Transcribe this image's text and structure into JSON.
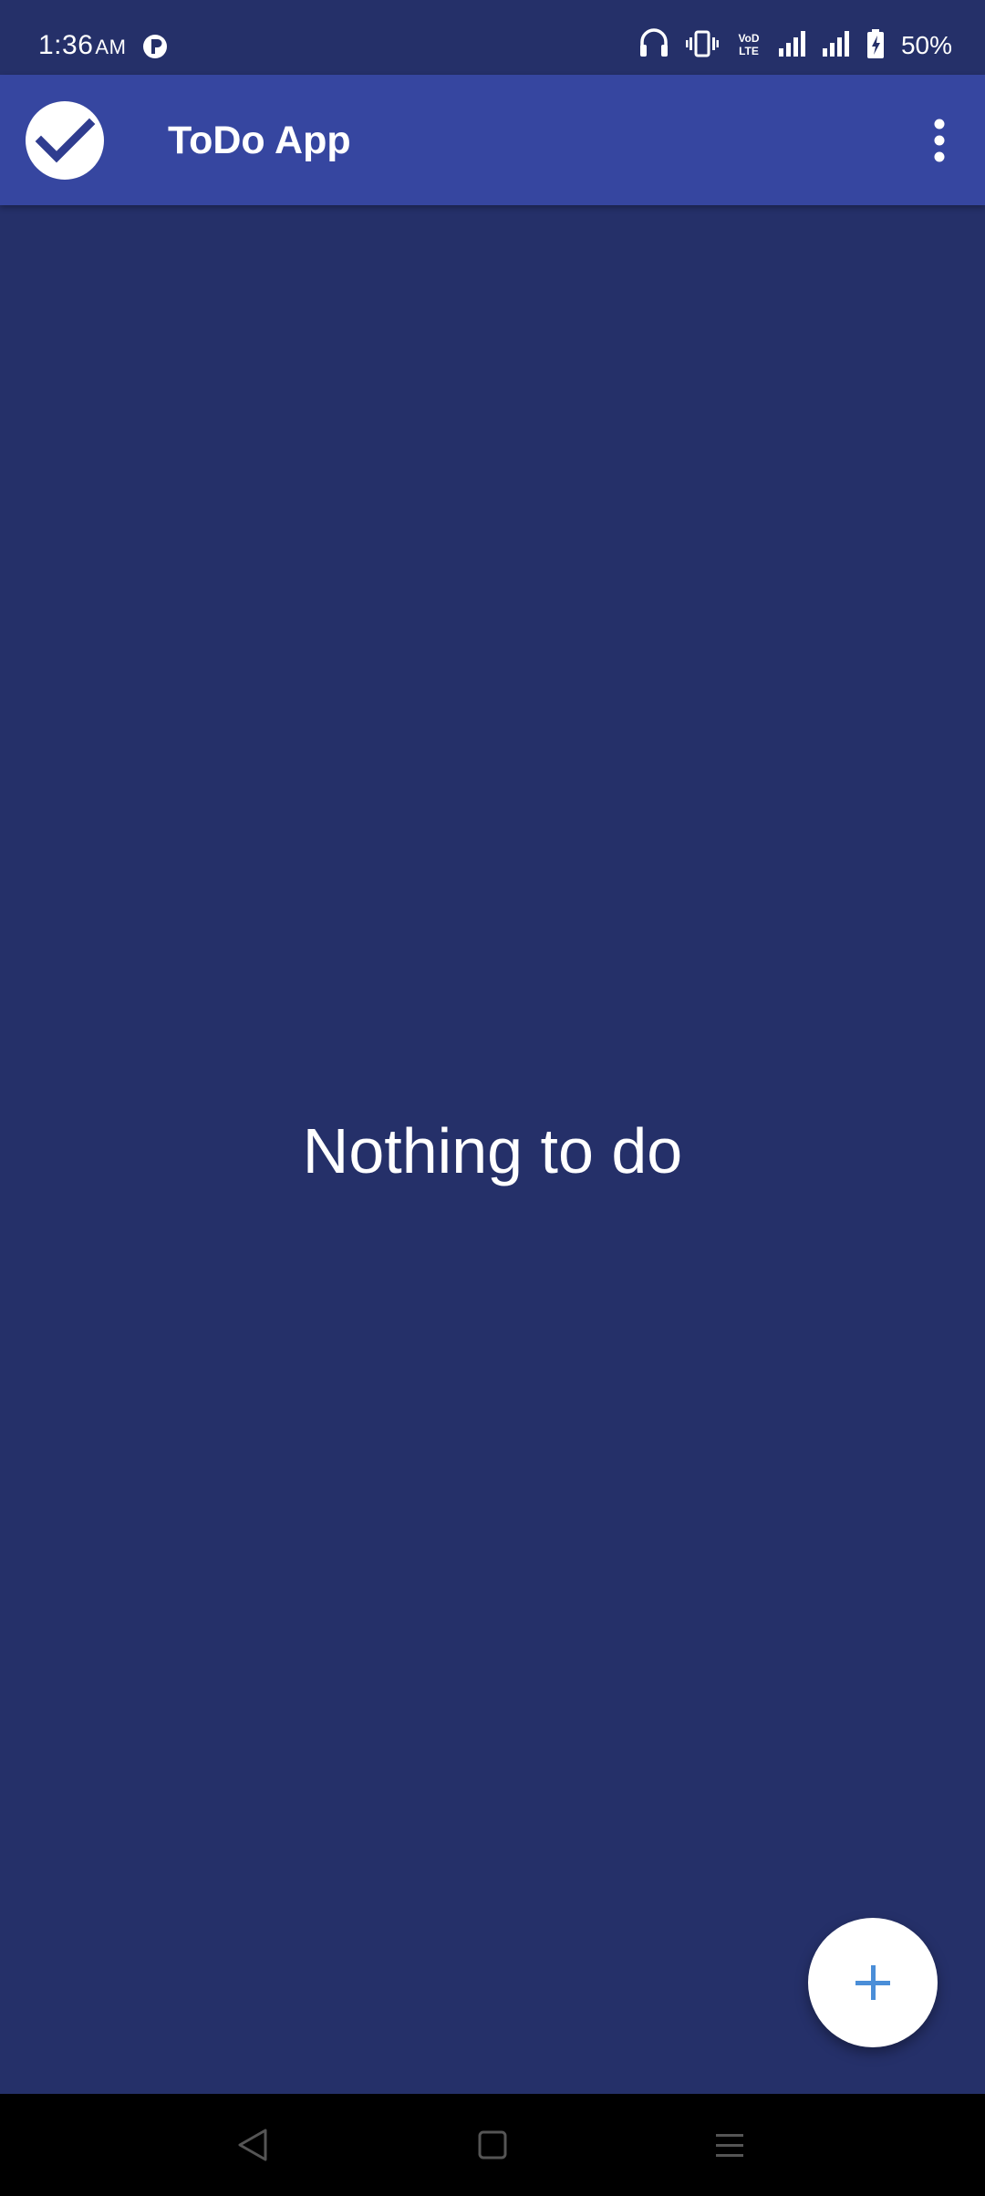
{
  "status_bar": {
    "time": "1:36",
    "ampm": "AM",
    "battery_percent": "50%",
    "icons": [
      "app-notification-icon",
      "headset-icon",
      "vibrate-icon",
      "volte-icon",
      "signal-icon",
      "signal-icon",
      "battery-charging-icon"
    ]
  },
  "app_bar": {
    "title": "ToDo App",
    "logo_icon": "check-circle-icon",
    "menu_icon": "more-vert-icon"
  },
  "main": {
    "empty_message": "Nothing to do"
  },
  "fab": {
    "icon": "plus-icon"
  },
  "nav_bar": {
    "buttons": [
      "back-icon",
      "home-icon",
      "recents-icon"
    ]
  },
  "colors": {
    "background": "#253069",
    "app_bar": "#3646a0",
    "fab_icon": "#4a8ed8",
    "logo_check": "#2f3c8f"
  }
}
